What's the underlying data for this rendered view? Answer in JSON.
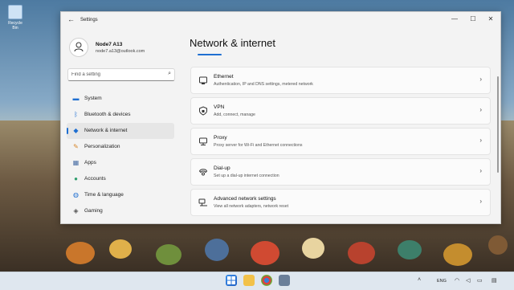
{
  "desktop": {
    "recycle_bin_label": "Recycle Bin"
  },
  "window": {
    "title": "Settings",
    "back_glyph": "←",
    "minimize_glyph": "—",
    "maximize_glyph": "☐",
    "close_glyph": "✕"
  },
  "user": {
    "name": "Node7 A13",
    "email": "node7.a13@outlook.com"
  },
  "search": {
    "placeholder": "Find a setting"
  },
  "nav": [
    {
      "label": "System",
      "icon": "monitor-icon",
      "active": false
    },
    {
      "label": "Bluetooth & devices",
      "icon": "bluetooth-icon",
      "active": false
    },
    {
      "label": "Network & internet",
      "icon": "wifi-icon",
      "active": true
    },
    {
      "label": "Personalization",
      "icon": "brush-icon",
      "active": false
    },
    {
      "label": "Apps",
      "icon": "apps-icon",
      "active": false
    },
    {
      "label": "Accounts",
      "icon": "person-icon",
      "active": false
    },
    {
      "label": "Time & language",
      "icon": "globe-clock-icon",
      "active": false
    },
    {
      "label": "Gaming",
      "icon": "gamepad-icon",
      "active": false
    }
  ],
  "main": {
    "title": "Network & internet",
    "items": [
      {
        "title": "Ethernet",
        "desc": "Authentication, IP and DNS settings, metered network",
        "icon": "ethernet-icon"
      },
      {
        "title": "VPN",
        "desc": "Add, connect, manage",
        "icon": "shield-icon"
      },
      {
        "title": "Proxy",
        "desc": "Proxy server for Wi-Fi and Ethernet connections",
        "icon": "proxy-icon"
      },
      {
        "title": "Dial-up",
        "desc": "Set up a dial-up internet connection",
        "icon": "phone-icon"
      },
      {
        "title": "Advanced network settings",
        "desc": "View all network adapters, network reset",
        "icon": "network-icon"
      }
    ],
    "chevron_glyph": "›"
  },
  "taskbar": {
    "language": "ENG"
  },
  "colors": {
    "accent": "#1f6fd1"
  }
}
